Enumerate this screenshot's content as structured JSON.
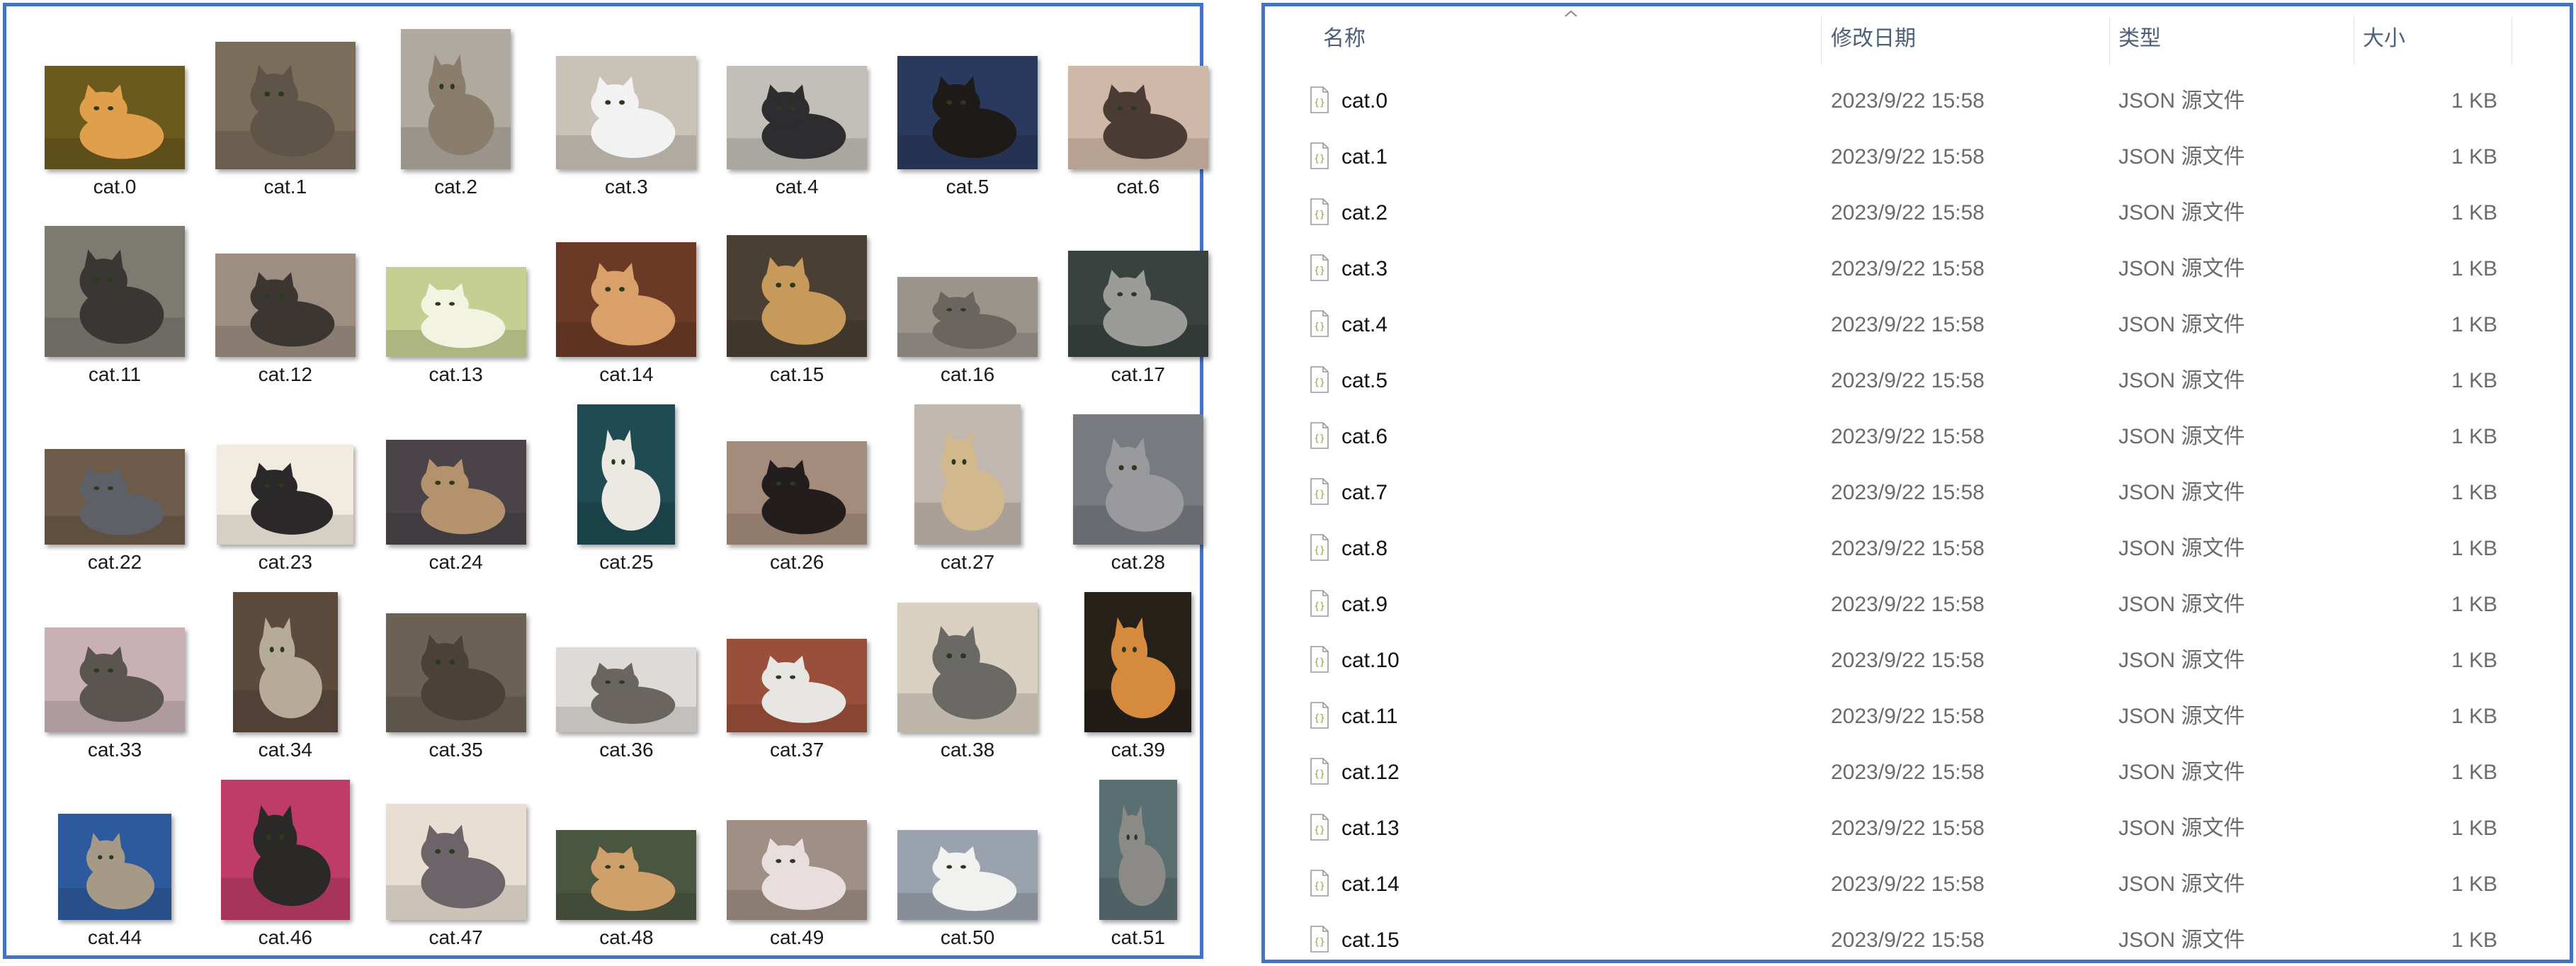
{
  "gallery": {
    "items": [
      {
        "label": "cat.0"
      },
      {
        "label": "cat.1"
      },
      {
        "label": "cat.2"
      },
      {
        "label": "cat.3"
      },
      {
        "label": "cat.4"
      },
      {
        "label": "cat.5"
      },
      {
        "label": "cat.6"
      },
      {
        "label": "cat.11"
      },
      {
        "label": "cat.12"
      },
      {
        "label": "cat.13"
      },
      {
        "label": "cat.14"
      },
      {
        "label": "cat.15"
      },
      {
        "label": "cat.16"
      },
      {
        "label": "cat.17"
      },
      {
        "label": "cat.22"
      },
      {
        "label": "cat.23"
      },
      {
        "label": "cat.24"
      },
      {
        "label": "cat.25"
      },
      {
        "label": "cat.26"
      },
      {
        "label": "cat.27"
      },
      {
        "label": "cat.28"
      },
      {
        "label": "cat.33"
      },
      {
        "label": "cat.34"
      },
      {
        "label": "cat.35"
      },
      {
        "label": "cat.36"
      },
      {
        "label": "cat.37"
      },
      {
        "label": "cat.38"
      },
      {
        "label": "cat.39"
      },
      {
        "label": "cat.44"
      },
      {
        "label": "cat.46"
      },
      {
        "label": "cat.47"
      },
      {
        "label": "cat.48"
      },
      {
        "label": "cat.49"
      },
      {
        "label": "cat.50"
      },
      {
        "label": "cat.51"
      }
    ]
  },
  "explorer": {
    "columns": {
      "name": "名称",
      "date": "修改日期",
      "type": "类型",
      "size": "大小"
    },
    "sort_icon": "chevron-up-icon",
    "file_icon": "json-file-icon",
    "rows": [
      {
        "name": "cat.0",
        "date": "2023/9/22 15:58",
        "type": "JSON 源文件",
        "size": "1 KB"
      },
      {
        "name": "cat.1",
        "date": "2023/9/22 15:58",
        "type": "JSON 源文件",
        "size": "1 KB"
      },
      {
        "name": "cat.2",
        "date": "2023/9/22 15:58",
        "type": "JSON 源文件",
        "size": "1 KB"
      },
      {
        "name": "cat.3",
        "date": "2023/9/22 15:58",
        "type": "JSON 源文件",
        "size": "1 KB"
      },
      {
        "name": "cat.4",
        "date": "2023/9/22 15:58",
        "type": "JSON 源文件",
        "size": "1 KB"
      },
      {
        "name": "cat.5",
        "date": "2023/9/22 15:58",
        "type": "JSON 源文件",
        "size": "1 KB"
      },
      {
        "name": "cat.6",
        "date": "2023/9/22 15:58",
        "type": "JSON 源文件",
        "size": "1 KB"
      },
      {
        "name": "cat.7",
        "date": "2023/9/22 15:58",
        "type": "JSON 源文件",
        "size": "1 KB"
      },
      {
        "name": "cat.8",
        "date": "2023/9/22 15:58",
        "type": "JSON 源文件",
        "size": "1 KB"
      },
      {
        "name": "cat.9",
        "date": "2023/9/22 15:58",
        "type": "JSON 源文件",
        "size": "1 KB"
      },
      {
        "name": "cat.10",
        "date": "2023/9/22 15:58",
        "type": "JSON 源文件",
        "size": "1 KB"
      },
      {
        "name": "cat.11",
        "date": "2023/9/22 15:58",
        "type": "JSON 源文件",
        "size": "1 KB"
      },
      {
        "name": "cat.12",
        "date": "2023/9/22 15:58",
        "type": "JSON 源文件",
        "size": "1 KB"
      },
      {
        "name": "cat.13",
        "date": "2023/9/22 15:58",
        "type": "JSON 源文件",
        "size": "1 KB"
      },
      {
        "name": "cat.14",
        "date": "2023/9/22 15:58",
        "type": "JSON 源文件",
        "size": "1 KB"
      },
      {
        "name": "cat.15",
        "date": "2023/9/22 15:58",
        "type": "JSON 源文件",
        "size": "1 KB"
      }
    ]
  },
  "colors": {
    "panel_border": "#4472C4",
    "header_text": "#4c607a",
    "secondary_text": "#6b6b6b"
  }
}
